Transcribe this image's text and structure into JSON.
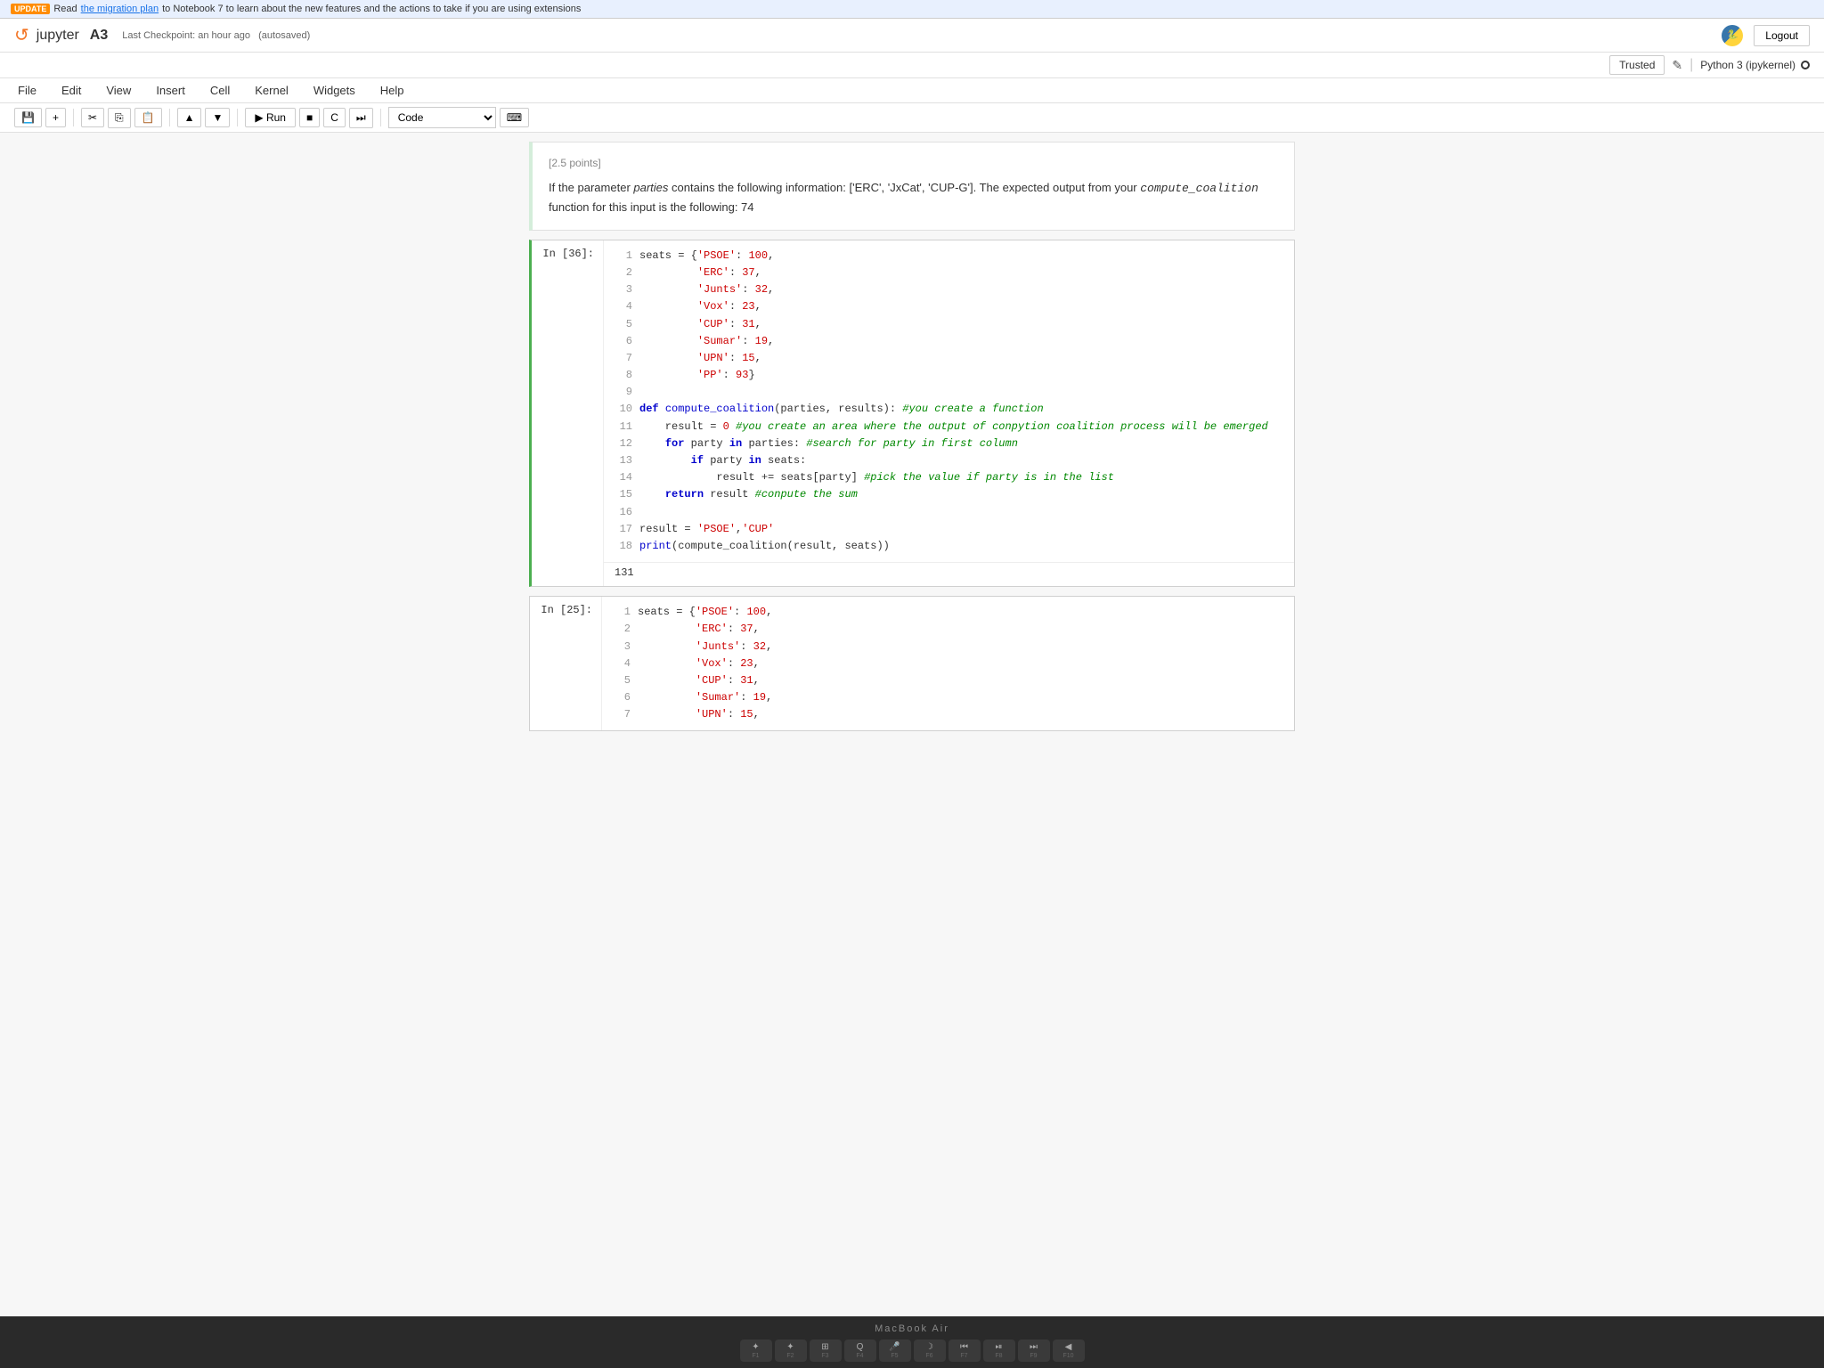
{
  "banner": {
    "badge": "UPDATE",
    "text": "Read the migration plan to Notebook 7 to learn about the new features and the actions to take if you are using extensions",
    "link_text": "the migration plan"
  },
  "header": {
    "logo": "↺",
    "app_name": "jupyter",
    "notebook_name": "A3",
    "checkpoint": "Last Checkpoint: an hour ago",
    "autosaved": "(autosaved)",
    "trusted_label": "Trusted",
    "edit_label": "✎",
    "kernel_label": "Python 3 (ipykernel)",
    "logout_label": "Logout"
  },
  "menu": {
    "items": [
      "File",
      "Edit",
      "View",
      "Insert",
      "Cell",
      "Kernel",
      "Widgets",
      "Help"
    ]
  },
  "toolbar": {
    "buttons": [
      "save",
      "add",
      "cut",
      "copy",
      "paste",
      "move_up",
      "move_down"
    ],
    "run_label": "Run",
    "stop_label": "■",
    "restart_label": "C",
    "fast_forward_label": "⏭",
    "cell_type": "Code"
  },
  "cells": [
    {
      "type": "markdown",
      "id": "markdown-1",
      "header": "[2.5 points]",
      "content": "If the parameter parties contains the following information: ['ERC', 'JxCat', 'CUP-G']. The expected output from your compute_coalition function for this input is the following: 74",
      "italic_words": [
        "parties",
        "compute_coalition"
      ]
    },
    {
      "type": "code",
      "id": "cell-36",
      "label": "In [36]:",
      "active": true,
      "lines": [
        {
          "num": 1,
          "content": "seats = {'PSOE': 100,"
        },
        {
          "num": 2,
          "content": "         'ERC': 37,"
        },
        {
          "num": 3,
          "content": "         'Junts': 32,"
        },
        {
          "num": 4,
          "content": "         'Vox': 23,"
        },
        {
          "num": 5,
          "content": "         'CUP': 31,"
        },
        {
          "num": 6,
          "content": "         'Sumar': 19,"
        },
        {
          "num": 7,
          "content": "         'UPN': 15,"
        },
        {
          "num": 8,
          "content": "         'PP': 93}"
        },
        {
          "num": 9,
          "content": ""
        },
        {
          "num": 10,
          "content": "def compute_coalition(parties, results): #you create a function"
        },
        {
          "num": 11,
          "content": "    result = 0 #you create an area where the output of conpytion coalition process will be emerged"
        },
        {
          "num": 12,
          "content": "    for party in parties: #search for party in first column"
        },
        {
          "num": 13,
          "content": "        if party in seats:"
        },
        {
          "num": 14,
          "content": "            result += seats[party] #pick the value if party is in the list"
        },
        {
          "num": 15,
          "content": "    return result #conpute the sum"
        },
        {
          "num": 16,
          "content": ""
        },
        {
          "num": 17,
          "content": "result = 'PSOE','CUP'"
        },
        {
          "num": 18,
          "content": "print(compute_coalition(result, seats))"
        }
      ],
      "output": "131"
    },
    {
      "type": "code",
      "id": "cell-25",
      "label": "In [25]:",
      "active": false,
      "lines": [
        {
          "num": 1,
          "content": "seats = {'PSOE': 100,"
        },
        {
          "num": 2,
          "content": "         'ERC': 37,"
        },
        {
          "num": 3,
          "content": "         'Junts': 32,"
        },
        {
          "num": 4,
          "content": "         'Vox': 23,"
        },
        {
          "num": 5,
          "content": "         'CUP': 31,"
        },
        {
          "num": 6,
          "content": "         'Sumar': 19,"
        },
        {
          "num": 7,
          "content": "         'UPN': 15,"
        }
      ],
      "output": null
    }
  ],
  "macbook_label": "MacBook Air",
  "keyboard": {
    "row1": [
      {
        "icon": "✦",
        "label": "F1"
      },
      {
        "icon": "✦",
        "label": "F2"
      },
      {
        "icon": "⊞",
        "label": "F3"
      },
      {
        "icon": "Q",
        "label": "F4"
      },
      {
        "icon": "🎤",
        "label": "F5"
      },
      {
        "icon": "☽",
        "label": "F6"
      },
      {
        "icon": "⏮",
        "label": "F7"
      },
      {
        "icon": "⏯",
        "label": ""
      },
      {
        "icon": "⏭",
        "label": ""
      },
      {
        "icon": "◀",
        "label": ""
      }
    ]
  }
}
